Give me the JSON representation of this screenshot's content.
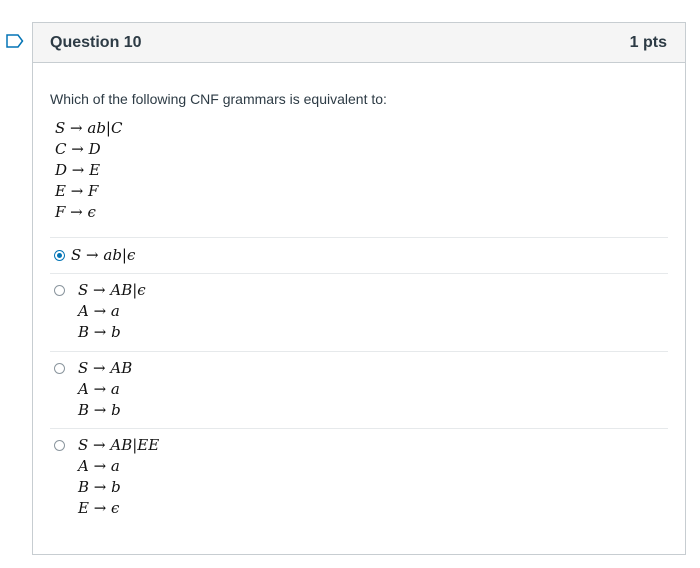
{
  "question": {
    "title": "Question 10",
    "points": "1 pts",
    "prompt": "Which of the following CNF grammars is equivalent to:",
    "grammar": [
      "S → ab|C",
      "C → D",
      "D → E",
      "E → F",
      "F → ϵ"
    ]
  },
  "answers": [
    {
      "selected": true,
      "lines": [
        "S → ab|ϵ"
      ]
    },
    {
      "selected": false,
      "lines": [
        "S → AB|ϵ",
        "A → a",
        "B → b"
      ]
    },
    {
      "selected": false,
      "lines": [
        "S → AB",
        "A → a",
        "B → b"
      ]
    },
    {
      "selected": false,
      "lines": [
        "S → AB|EE",
        "A → a",
        "B → b",
        "E → ϵ"
      ]
    }
  ],
  "colors": {
    "accent": "#0374b5",
    "header_bg": "#f5f5f5",
    "border": "#c7cdd1",
    "text": "#2d3b45"
  },
  "icons": {
    "flag": "bookmark-flag-icon"
  }
}
